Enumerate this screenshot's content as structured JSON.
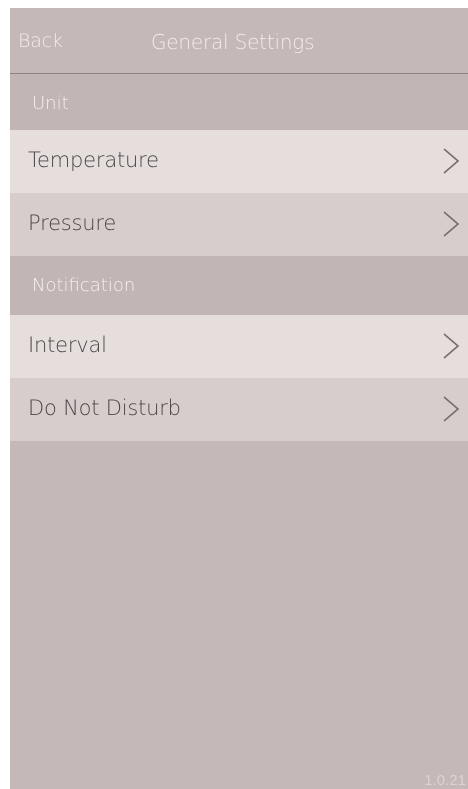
{
  "nav": {
    "back_label": "Back",
    "title": "General Settings"
  },
  "sections": [
    {
      "header": "Unit",
      "items": [
        {
          "label": "Temperature",
          "icon": "chevron-right-icon"
        },
        {
          "label": "Pressure",
          "icon": "chevron-right-icon"
        }
      ]
    },
    {
      "header": "Notification",
      "items": [
        {
          "label": "Interval",
          "icon": "chevron-right-icon"
        },
        {
          "label": "Do Not Disturb",
          "icon": "chevron-right-icon"
        }
      ]
    }
  ],
  "footer": {
    "version": "1.0.21"
  },
  "colors": {
    "background": "#c4b8b8",
    "row_light": "#e6dddd",
    "row_mid": "#d7cdcd",
    "text_dark": "#4b4646",
    "text_light": "#f3eded"
  }
}
